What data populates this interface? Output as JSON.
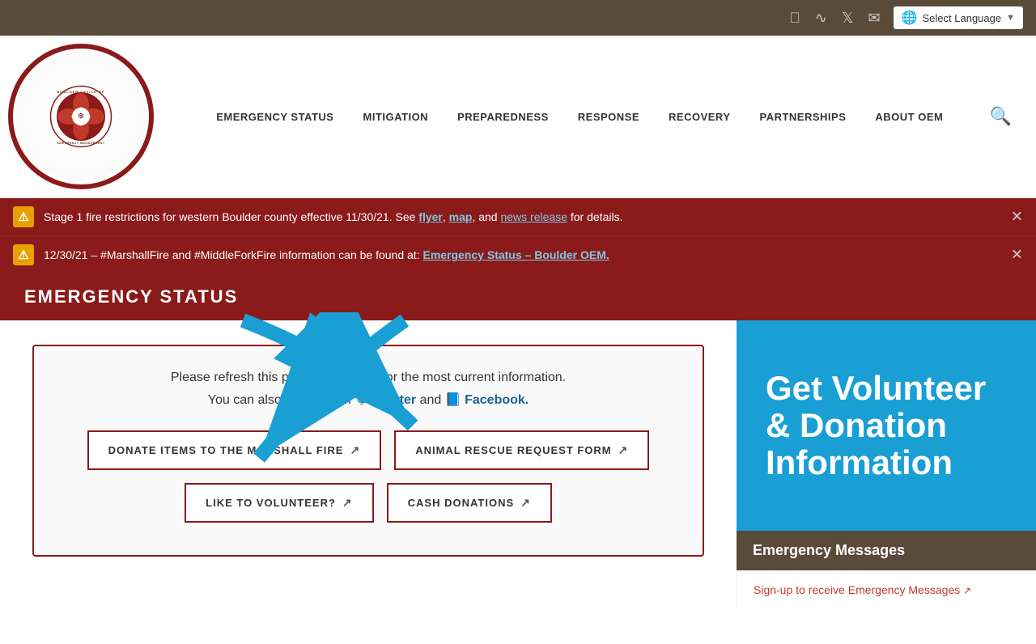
{
  "topbar": {
    "select_language": "Select Language",
    "icons": [
      "facebook",
      "rss",
      "twitter",
      "email"
    ]
  },
  "nav": {
    "items": [
      "EMERGENCY STATUS",
      "MITIGATION",
      "PREPAREDNESS",
      "RESPONSE",
      "RECOVERY",
      "PARTNERSHIPS",
      "ABOUT OEM"
    ]
  },
  "logo": {
    "alt": "Boulder Office of Emergency Management",
    "top_text": "BOULDER OFFICE OF",
    "bottom_text": "EMERGENCY MANAGEMENT"
  },
  "alerts": [
    {
      "text": "Stage 1 fire restrictions for western Boulder county effective 11/30/21. See",
      "links": [
        {
          "label": "flyer",
          "href": "#"
        },
        {
          "label": "map",
          "href": "#"
        },
        {
          "label": "news release",
          "href": "#"
        }
      ],
      "suffix": "for details."
    },
    {
      "text": "12/30/21 – #MarshallFire and #MiddleForkFire information can be found at:",
      "link_label": "Emergency Status – Boulder OEM.",
      "link_href": "#"
    }
  ],
  "emergency_status": {
    "title": "EMERGENCY STATUS"
  },
  "main": {
    "refresh_text": "Please refresh this page periodically for the most current information.",
    "follow_text": "You can also follow OEM",
    "twitter_label": "Twitter",
    "and_text": "and",
    "facebook_label": "Facebook.",
    "buttons": [
      {
        "label": "DONATE ITEMS TO THE MARSHALL FIRE",
        "icon": "↗"
      },
      {
        "label": "ANIMAL RESCUE REQUEST FORM",
        "icon": "↗"
      },
      {
        "label": "LIKE TO VOLUNTEER?",
        "icon": "↗"
      },
      {
        "label": "CASH DONATIONS",
        "icon": "↗"
      }
    ]
  },
  "volunteer_box": {
    "line1": "Get Volunteer",
    "line2": "& Donation",
    "line3": "Information"
  },
  "emergency_messages": {
    "title": "Emergency Messages",
    "signup_text": "Sign-up to receive Emergency Messages",
    "signup_icon": "↗"
  }
}
